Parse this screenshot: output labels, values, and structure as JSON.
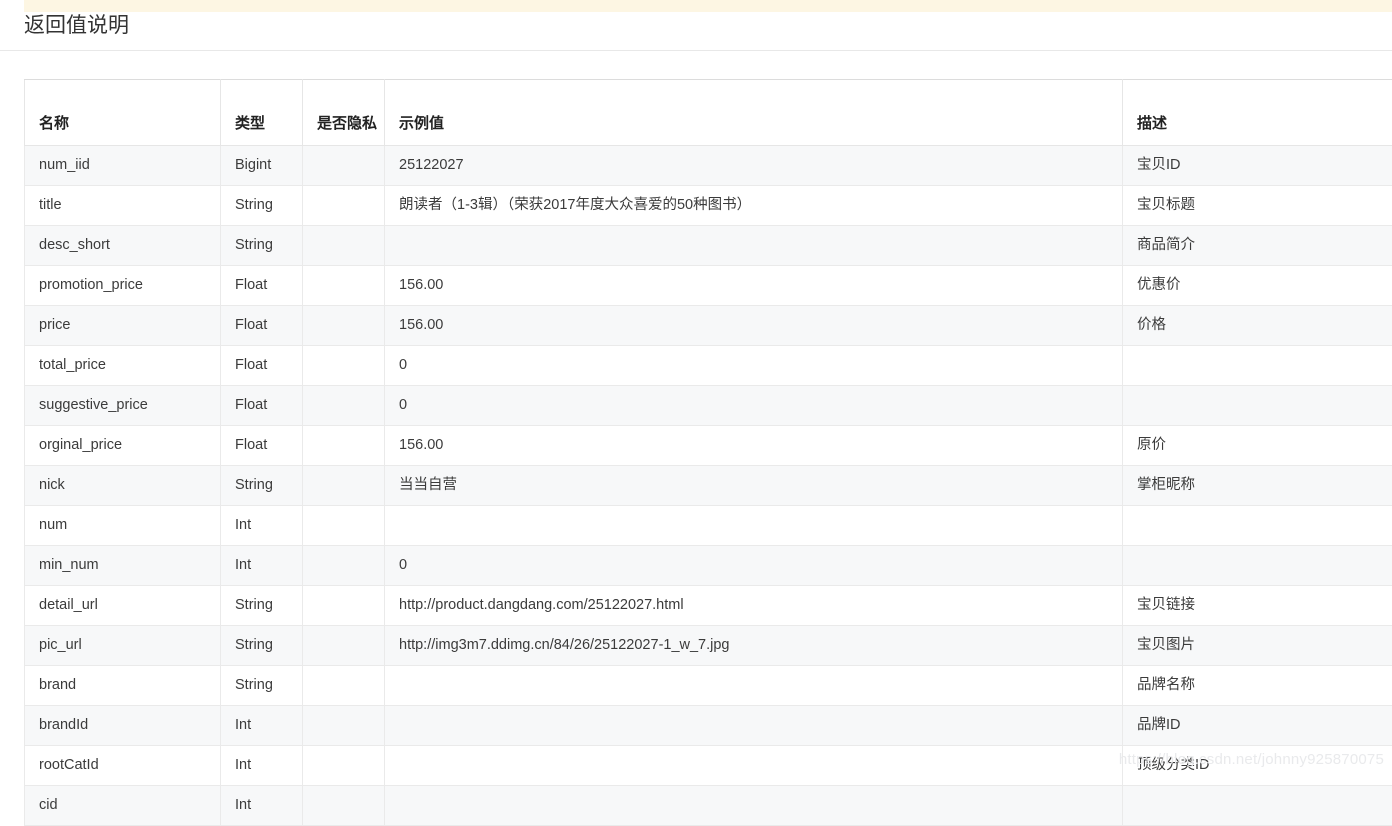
{
  "page": {
    "section_title": "返回值说明",
    "watermark": "https://blog.csdn.net/johnny925870075"
  },
  "table": {
    "headers": {
      "name": "名称",
      "type": "类型",
      "private": "是否隐私",
      "sample": "示例值",
      "desc": "描述"
    },
    "rows": [
      {
        "name": "num_iid",
        "type": "Bigint",
        "private": "",
        "sample": "25122027",
        "desc": "宝贝ID"
      },
      {
        "name": "title",
        "type": "String",
        "private": "",
        "sample": "朗读者（1-3辑）（荣获2017年度大众喜爱的50种图书）",
        "desc": "宝贝标题"
      },
      {
        "name": "desc_short",
        "type": "String",
        "private": "",
        "sample": "",
        "desc": "商品简介"
      },
      {
        "name": "promotion_price",
        "type": "Float",
        "private": "",
        "sample": "156.00",
        "desc": "优惠价"
      },
      {
        "name": "price",
        "type": "Float",
        "private": "",
        "sample": "156.00",
        "desc": "价格"
      },
      {
        "name": "total_price",
        "type": "Float",
        "private": "",
        "sample": "0",
        "desc": ""
      },
      {
        "name": "suggestive_price",
        "type": "Float",
        "private": "",
        "sample": "0",
        "desc": ""
      },
      {
        "name": "orginal_price",
        "type": "Float",
        "private": "",
        "sample": "156.00",
        "desc": "原价"
      },
      {
        "name": "nick",
        "type": "String",
        "private": "",
        "sample": "当当自营",
        "desc": "掌柜昵称"
      },
      {
        "name": "num",
        "type": "Int",
        "private": "",
        "sample": "",
        "desc": ""
      },
      {
        "name": "min_num",
        "type": "Int",
        "private": "",
        "sample": "0",
        "desc": ""
      },
      {
        "name": "detail_url",
        "type": "String",
        "private": "",
        "sample": "http://product.dangdang.com/25122027.html",
        "desc": "宝贝链接"
      },
      {
        "name": "pic_url",
        "type": "String",
        "private": "",
        "sample": "http://img3m7.ddimg.cn/84/26/25122027-1_w_7.jpg",
        "desc": "宝贝图片"
      },
      {
        "name": "brand",
        "type": "String",
        "private": "",
        "sample": "",
        "desc": "品牌名称"
      },
      {
        "name": "brandId",
        "type": "Int",
        "private": "",
        "sample": "",
        "desc": "品牌ID"
      },
      {
        "name": "rootCatId",
        "type": "Int",
        "private": "",
        "sample": "",
        "desc": "顶级分类ID"
      },
      {
        "name": "cid",
        "type": "Int",
        "private": "",
        "sample": "",
        "desc": ""
      }
    ]
  }
}
